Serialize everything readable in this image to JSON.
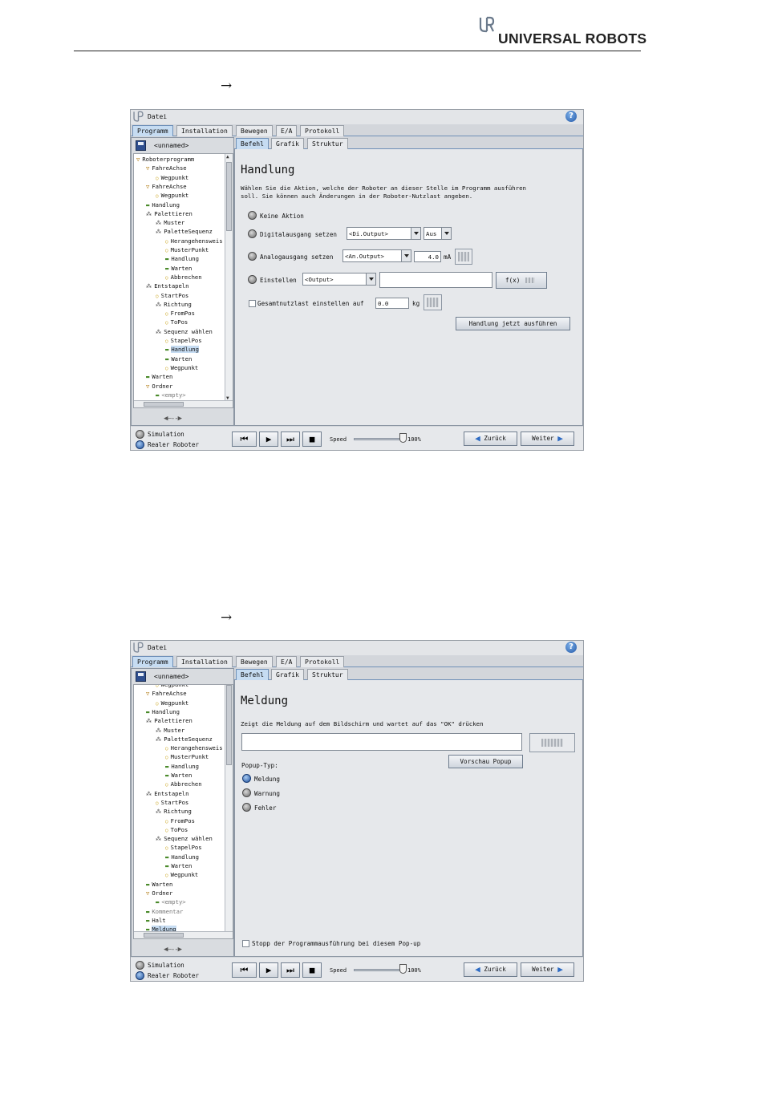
{
  "header": {
    "brand": "UNIVERSAL ROBOTS"
  },
  "page": {
    "arrow_symbol": "→"
  },
  "screens": [
    {
      "menu": {
        "file": "Datei",
        "help": "?"
      },
      "main_tabs": [
        "Programm",
        "Installation",
        "Bewegen",
        "E/A",
        "Protokoll"
      ],
      "file_name": "<unnamed>",
      "tree": [
        "Roboterprogramm",
        "FahreAchse",
        "Wegpunkt",
        "FahreAchse",
        "Wegpunkt",
        "Handlung",
        "Palettieren",
        "Muster",
        "PaletteSequenz",
        "Herangehensweis",
        "MusterPunkt",
        "Handlung",
        "Warten",
        "Abbrechen",
        "Entstapeln",
        "StartPos",
        "Richtung",
        "FromPos",
        "ToPos",
        "Sequenz wählen",
        "StapelPos",
        "Handlung",
        "Warten",
        "Wegpunkt",
        "Warten",
        "Ordner",
        "<empty>"
      ],
      "sub_tabs": [
        "Befehl",
        "Grafik",
        "Struktur"
      ],
      "title": "Handlung",
      "description_line1": "Wählen Sie die Aktion, welche der Roboter an dieser Stelle im Programm ausführen",
      "description_line2": "soll. Sie können auch Änderungen in der Roboter-Nutzlast angeben.",
      "opt_none": "Keine Aktion",
      "opt_digital": "Digitalausgang setzen",
      "digital_output": "<Di.Output>",
      "digital_value": "Aus",
      "opt_analog": "Analogausgang setzen",
      "analog_output": "<An.Output>",
      "analog_value": "4.0",
      "analog_unit": "mA",
      "opt_set": "Einstellen",
      "set_output": "<Output>",
      "set_expression": "",
      "fx_label": "f(x)",
      "payload_label": "Gesamtnutzlast einstellen auf",
      "payload_value": "0.0",
      "payload_unit": "kg",
      "run_button": "Handlung jetzt ausführen",
      "modes": [
        "Simulation",
        "Realer Roboter"
      ],
      "speed_label": "Speed",
      "speed_value": "100%",
      "speed_fraction": 1.0,
      "back": "Zurück",
      "next": "Weiter"
    },
    {
      "menu": {
        "file": "Datei",
        "help": "?"
      },
      "main_tabs": [
        "Programm",
        "Installation",
        "Bewegen",
        "E/A",
        "Protokoll"
      ],
      "file_name": "<unnamed>",
      "tree": [
        "Wegpunkt",
        "FahreAchse",
        "Wegpunkt",
        "Handlung",
        "Palettieren",
        "Muster",
        "PaletteSequenz",
        "Herangehensweis",
        "MusterPunkt",
        "Handlung",
        "Warten",
        "Abbrechen",
        "Entstapeln",
        "StartPos",
        "Richtung",
        "FromPos",
        "ToPos",
        "Sequenz wählen",
        "StapelPos",
        "Handlung",
        "Warten",
        "Wegpunkt",
        "Warten",
        "Ordner",
        "<empty>",
        "Kommentar",
        "Halt",
        "Meldung"
      ],
      "sub_tabs": [
        "Befehl",
        "Grafik",
        "Struktur"
      ],
      "title": "Meldung",
      "description": "Zeigt die Meldung auf dem Bildschirm und wartet auf das \"OK\" drücken",
      "message_value": "",
      "preview_button": "Vorschau Popup",
      "popup_type_label": "Popup-Typ:",
      "popup_types": [
        "Meldung",
        "Warnung",
        "Fehler"
      ],
      "stop_label": "Stopp der Programmausführung bei diesem Pop-up",
      "modes": [
        "Simulation",
        "Realer Roboter"
      ],
      "speed_label": "Speed",
      "speed_value": "100%",
      "speed_fraction": 1.0,
      "back": "Zurück",
      "next": "Weiter"
    }
  ],
  "colors": {
    "accent": "#2459a8",
    "tab_active": "#c6dcf2",
    "panel": "#e6e8eb"
  }
}
